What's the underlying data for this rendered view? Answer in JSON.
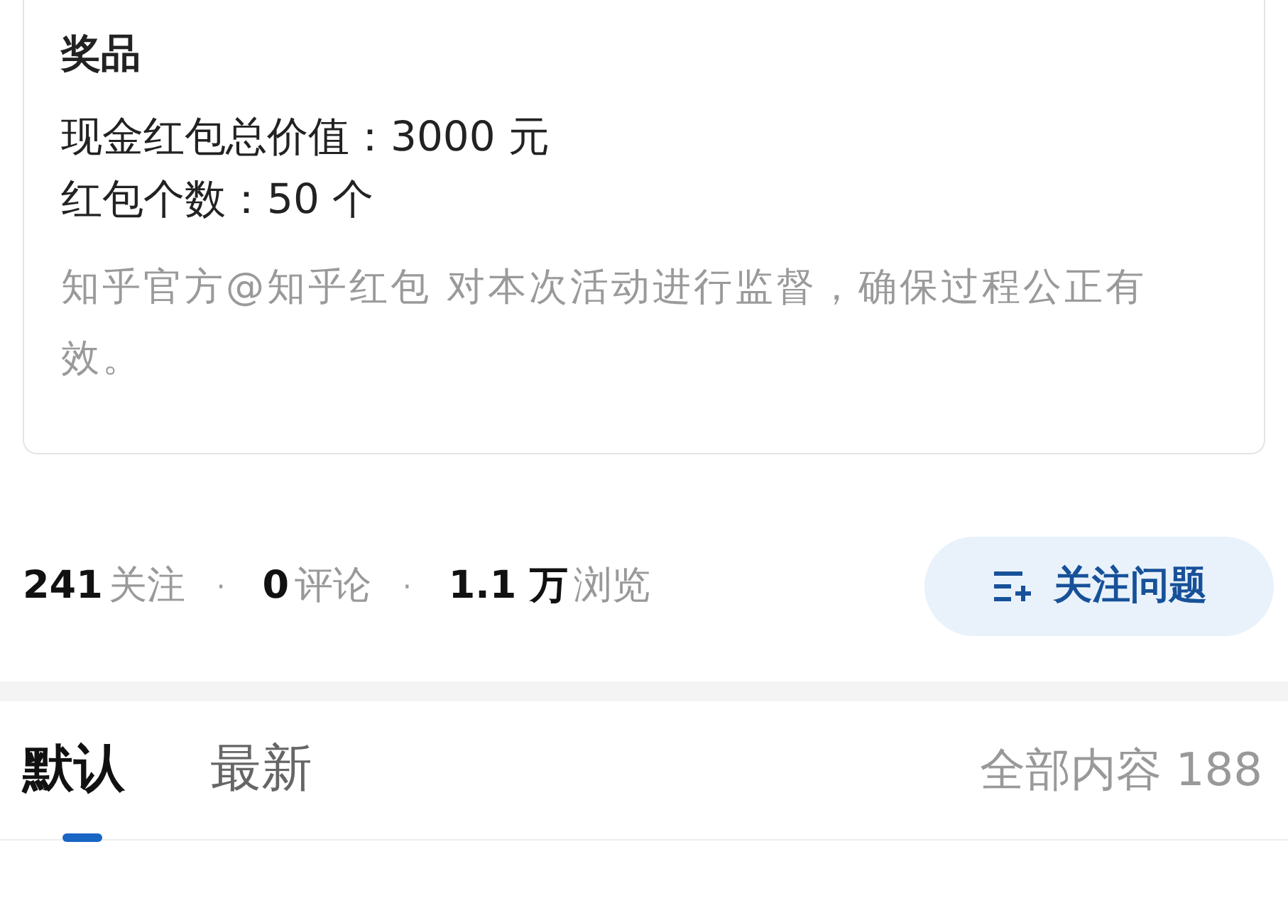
{
  "prize_card": {
    "title": "奖品",
    "lines": [
      "现金红包总价值：3000 元",
      "红包个数：50 个"
    ],
    "note": "知乎官方@知乎红包 对本次活动进行监督，确保过程公正有效。"
  },
  "stats": {
    "separator": "·",
    "items": [
      {
        "value": "241",
        "label": "关注"
      },
      {
        "value": "0",
        "label": "评论"
      },
      {
        "value": "1.1 万",
        "label": "浏览"
      }
    ]
  },
  "follow_button": {
    "label": "关注问题"
  },
  "tabs": [
    {
      "label": "默认",
      "selected": true
    },
    {
      "label": "最新",
      "selected": false
    }
  ],
  "content_count": "全部内容 188"
}
